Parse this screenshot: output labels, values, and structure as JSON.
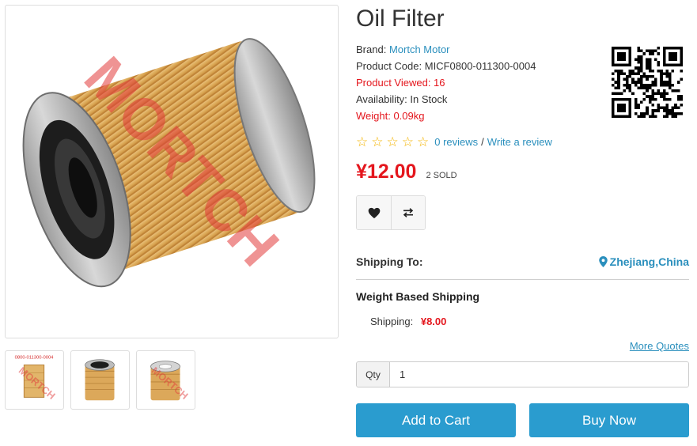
{
  "product": {
    "title": "Oil Filter",
    "brand_label": "Brand:",
    "brand_value": "Mortch Motor",
    "code_label": "Product Code:",
    "code_value": "MICF0800-011300-0004",
    "viewed_text": "Product Viewed: 16",
    "availability_label": "Availability:",
    "availability_value": "In Stock",
    "weight_text": "Weight: 0.09kg"
  },
  "watermark": "MORTCH",
  "thumb_label": "0800-011300-0004",
  "rating": {
    "stars": 5,
    "filled": 0,
    "reviews_text": "0 reviews",
    "separator": "/",
    "write_text": "Write a review"
  },
  "price": {
    "value": "¥12.00",
    "sold": "2 SOLD"
  },
  "icons": {
    "wishlist": "heart-icon",
    "compare": "exchange-arrows-icon",
    "location": "map-pin-icon"
  },
  "shipping": {
    "to_label": "Shipping To:",
    "location": "Zhejiang,China",
    "method": "Weight Based Shipping",
    "cost_label": "Shipping:",
    "cost_value": "¥8.00",
    "more_quotes": "More Quotes"
  },
  "qty": {
    "label": "Qty",
    "value": "1"
  },
  "buttons": {
    "add_to_cart": "Add to Cart",
    "buy_now": "Buy Now"
  },
  "colors": {
    "accent": "#2a9ccf",
    "link": "#2a8fbd",
    "price": "#e4161d",
    "star": "#f4b400"
  }
}
